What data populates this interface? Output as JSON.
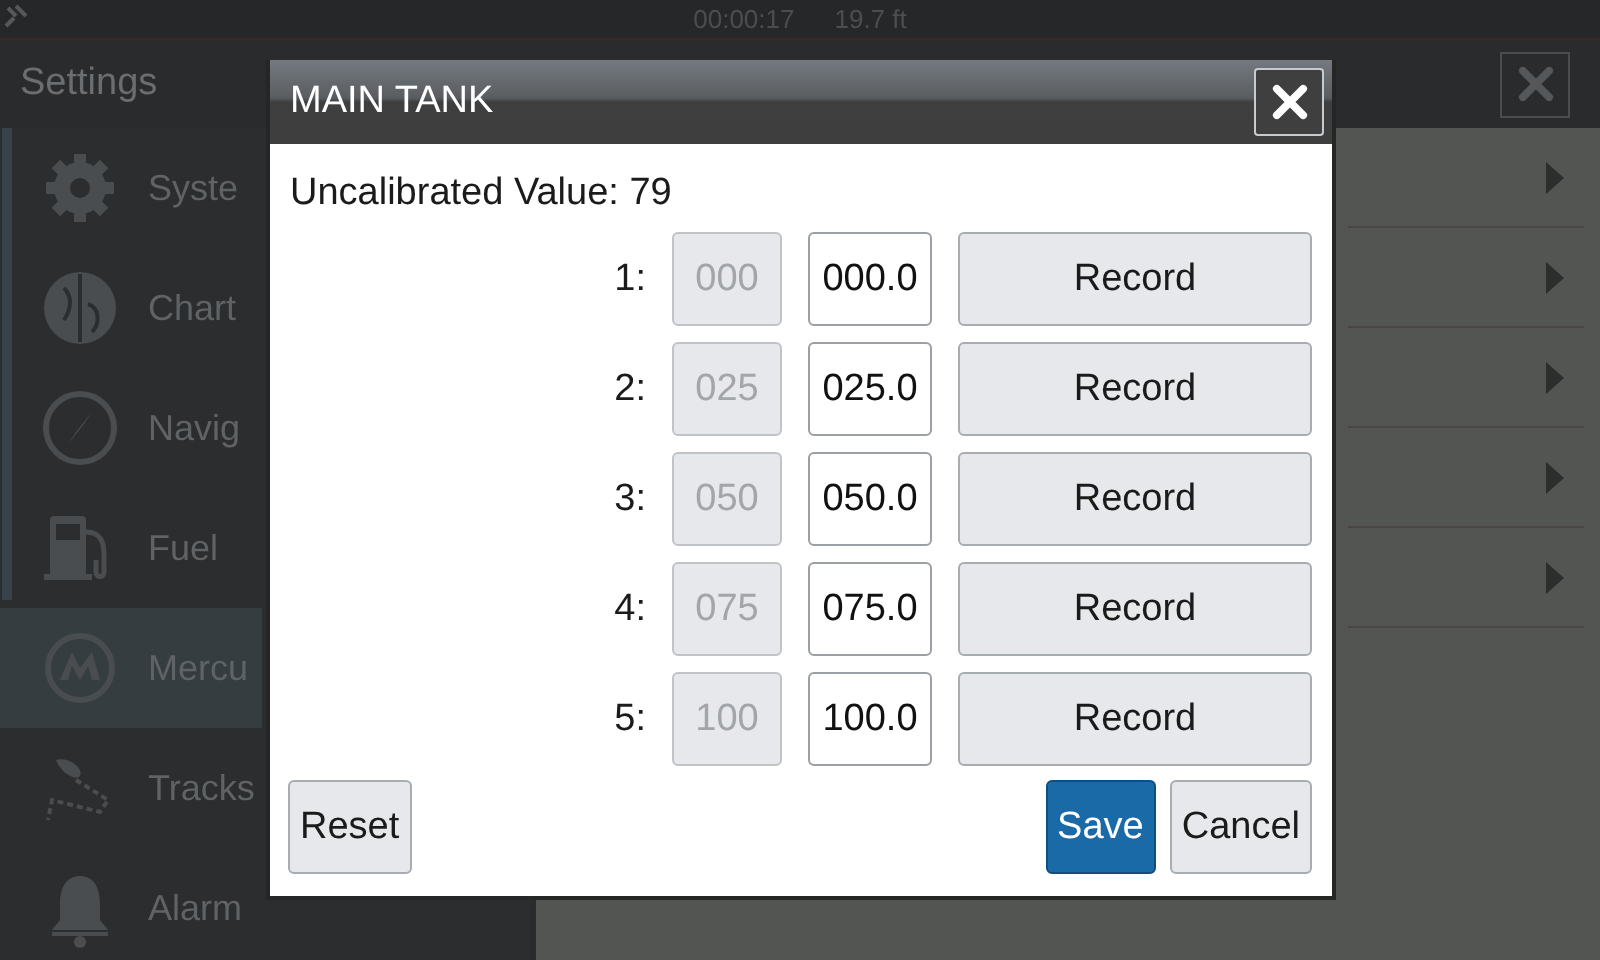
{
  "status_bar": {
    "time": "00:00:17",
    "depth": "19.7 ft"
  },
  "settings": {
    "title": "Settings",
    "items": [
      {
        "label": "Syste",
        "selected": false
      },
      {
        "label": "Chart",
        "selected": false
      },
      {
        "label": "Navig",
        "selected": false
      },
      {
        "label": "Fuel",
        "selected": false
      },
      {
        "label": "Mercu",
        "selected": true
      },
      {
        "label": "Tracks",
        "selected": false
      },
      {
        "label": "Alarm",
        "selected": false
      }
    ]
  },
  "dialog": {
    "title": "MAIN TANK",
    "uncalibrated": "Uncalibrated Value: 79",
    "points": [
      {
        "label": "1:",
        "raw": "000",
        "raw_disabled": true,
        "value": "000.0",
        "button": "Record"
      },
      {
        "label": "2:",
        "raw": "025",
        "raw_disabled": true,
        "value": "025.0",
        "button": "Record"
      },
      {
        "label": "3:",
        "raw": "050",
        "raw_disabled": true,
        "value": "050.0",
        "button": "Record"
      },
      {
        "label": "4:",
        "raw": "075",
        "raw_disabled": true,
        "value": "075.0",
        "button": "Record"
      },
      {
        "label": "5:",
        "raw": "100",
        "raw_disabled": true,
        "value": "100.0",
        "button": "Record"
      }
    ],
    "buttons": [
      {
        "label": "Reset",
        "selected": false
      },
      {
        "label": "Save",
        "selected": true
      },
      {
        "label": "Cancel",
        "selected": false
      }
    ]
  }
}
